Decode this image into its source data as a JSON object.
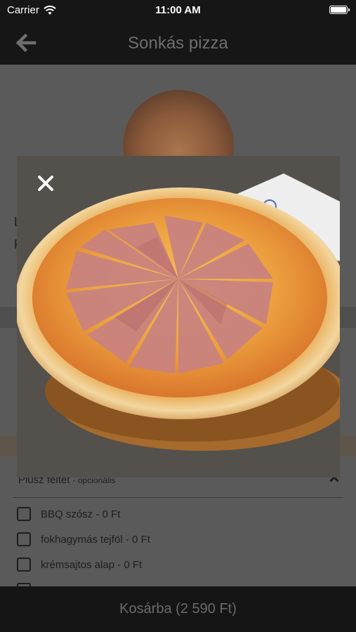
{
  "status_bar": {
    "carrier": "Carrier",
    "time": "11:00 AM"
  },
  "nav": {
    "title": "Sonkás pizza",
    "back_icon": "arrow-left-icon"
  },
  "background": {
    "peek_line_1": "L",
    "peek_line_2": "P"
  },
  "toppings": {
    "heading": "Plusz feltét",
    "optional_label": "- opcionális",
    "options": [
      {
        "label": "BBQ szósz - 0 Ft",
        "checked": false
      },
      {
        "label": "fokhagymás tejföl - 0 Ft",
        "checked": false
      },
      {
        "label": "krémsajtos alap - 0 Ft",
        "checked": false
      }
    ]
  },
  "modal": {
    "close_icon": "close-icon",
    "image": "pizza-photo"
  },
  "cart": {
    "label": "Kosárba (2 590 Ft)"
  }
}
